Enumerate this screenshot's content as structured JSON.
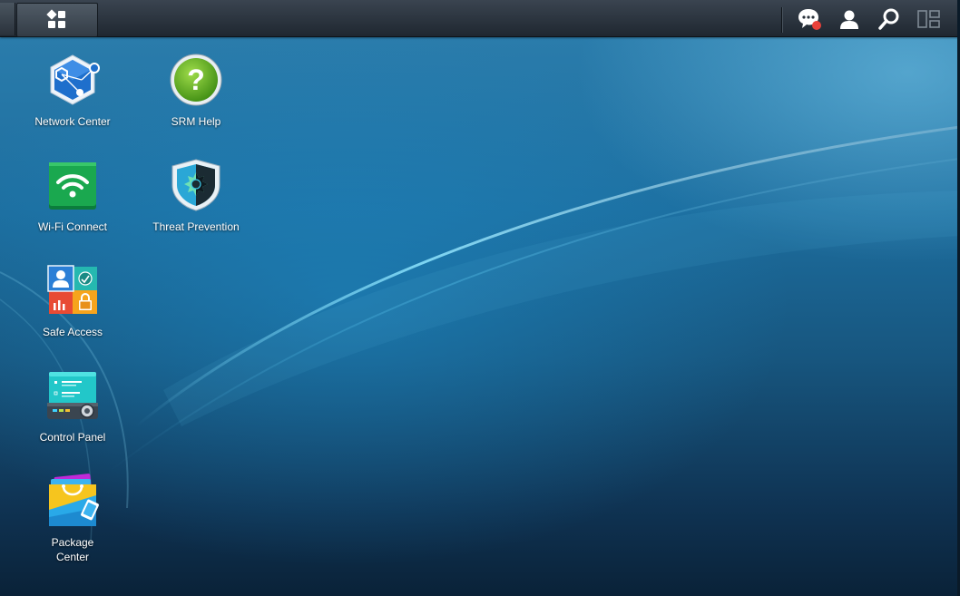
{
  "topbar": {
    "main_menu_icon": "main-menu-grid-icon",
    "icons": [
      "notification-chat-icon",
      "user-icon",
      "search-icon",
      "widgets-icon"
    ],
    "notification_dot_color": "#e8413a"
  },
  "desktop": {
    "apps": [
      {
        "label": "Network Center",
        "icon": "network-center-icon"
      },
      {
        "label": "SRM Help",
        "icon": "help-icon"
      },
      {
        "label": "Wi-Fi Connect",
        "icon": "wifi-icon"
      },
      {
        "label": "Threat Prevention",
        "icon": "threat-prevention-shield-icon"
      },
      {
        "label": "Safe Access",
        "icon": "safe-access-icon"
      },
      {
        "label": "Control Panel",
        "icon": "control-panel-icon"
      },
      {
        "label": "Package Center",
        "icon": "package-center-icon"
      }
    ]
  }
}
